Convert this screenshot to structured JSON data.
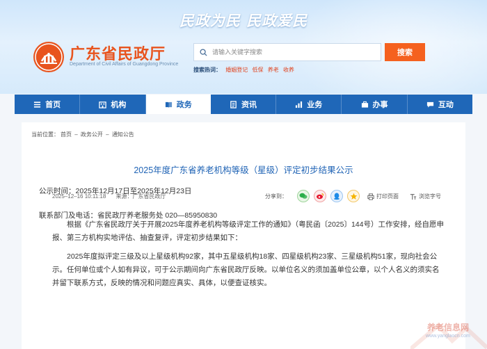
{
  "header": {
    "slogan": "民政为民  民政爱民",
    "site_name": "广东省民政厅",
    "site_subtitle": "Department of Civil Affairs of Guangdong Province",
    "logo_color": "#e8541e"
  },
  "search": {
    "placeholder": "请输入关键字搜索",
    "button_label": "搜索",
    "hot_label": "搜索热词：",
    "hot_words": [
      "婚姻登记",
      "低保",
      "养老",
      "收养"
    ]
  },
  "nav": {
    "items": [
      {
        "label": "首页",
        "icon": "home-icon"
      },
      {
        "label": "机构",
        "icon": "building-icon"
      },
      {
        "label": "政务",
        "icon": "book-icon",
        "active": true
      },
      {
        "label": "资讯",
        "icon": "document-icon"
      },
      {
        "label": "业务",
        "icon": "chart-icon"
      },
      {
        "label": "办事",
        "icon": "briefcase-icon"
      },
      {
        "label": "互动",
        "icon": "chat-icon"
      }
    ],
    "color": "#1f67b8"
  },
  "breadcrumb": {
    "prefix": "当前位置：",
    "items": [
      "首页",
      "政务公开",
      "通知公告"
    ],
    "separator": " – "
  },
  "article": {
    "title": "2025年度广东省养老机构等级（星级）评定初步结果公示",
    "date": "2025–12–16 10:11:18",
    "source": "来源：广东省民政厅",
    "share_label": "分享到：",
    "print_label": "打印页面",
    "font_label": "浏览字号",
    "paragraphs": [
      "根据《广东省民政厅关于开展2025年度养老机构等级评定工作的通知》（粤民函〔2025〕144号）工作安排，经自愿申报、第三方机构实地评估、抽查复评，评定初步结果如下：",
      "2025年度拟评定三级及以上星级机构92家，其中五星级机构18家、四星级机构23家、三星级机构51家，现向社会公示。任何单位或个人如有异议，可于公示期间向广东省民政厅反映。以单位名义的须加盖单位公章，以个人名义的须实名并留下联系方式，反映的情况和问题应真实、具体，以便查证核实。"
    ],
    "publicity_time": "公示时间：2025年12月17日至2025年12月23日",
    "contact": "联系部门及电话：省民政厅养老服务处  020—85950830"
  },
  "watermark": {
    "text": "养老信息网",
    "url": "www.yanglaocn.com"
  }
}
